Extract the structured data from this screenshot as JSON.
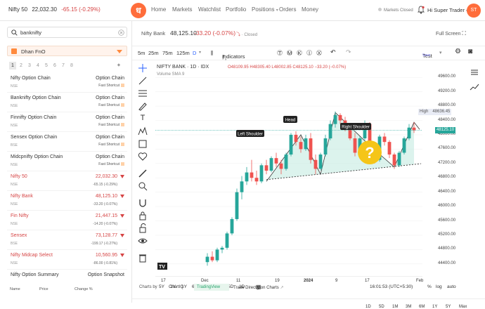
{
  "top": {
    "ticker_name": "Nifty 50",
    "ticker_price": "22,032.30",
    "ticker_change": "-65.15 (-0.29%)",
    "logo": "ध",
    "nav": [
      "Home",
      "Markets",
      "Watchlist",
      "Portfolio",
      "Positions",
      "Orders",
      "Money"
    ],
    "market_status": "Markets Closed",
    "user": "Hi Super Trader",
    "avatar": "ST"
  },
  "sidebar": {
    "search_value": "banknifty",
    "watchlist": "Dhan FnO",
    "pages": [
      "1",
      "2",
      "3",
      "4",
      "5",
      "6",
      "7",
      "8"
    ],
    "items": [
      {
        "name": "Nifty Option Chain",
        "ex": "NSE",
        "r1": "Option Chain",
        "r2": "Fast Shortcut"
      },
      {
        "name": "Banknifty Option Chain",
        "ex": "NSE",
        "r1": "Option Chain",
        "r2": "Fast Shortcut"
      },
      {
        "name": "Finnifty Option Chain",
        "ex": "NSE",
        "r1": "Option Chain",
        "r2": "Fast Shortcut"
      },
      {
        "name": "Sensex Option Chain",
        "ex": "BSE",
        "r1": "Option Chain",
        "r2": "Fast Shortcut"
      },
      {
        "name": "Midcpnifty Option Chain",
        "ex": "NSE",
        "r1": "Option Chain",
        "r2": "Fast Shortcut"
      }
    ],
    "quotes": [
      {
        "name": "Nifty 50",
        "ex": "NSE",
        "price": "22,032.30",
        "change": "-65.15 (-0.29%)"
      },
      {
        "name": "Nifty Bank",
        "ex": "NSE",
        "price": "48,125.10",
        "change": "-33.20 (-0.07%)"
      },
      {
        "name": "Fin Nifty",
        "ex": "NSE",
        "price": "21,447.15",
        "change": "-14.20 (-0.07%)"
      },
      {
        "name": "Sensex",
        "ex": "BSE",
        "price": "73,128.77",
        "change": "-199.17 (-0.27%)"
      },
      {
        "name": "Nifty Midcap Select",
        "ex": "NSE",
        "price": "10,560.95",
        "change": "-86.00 (-0.81%)"
      }
    ],
    "last_item": {
      "name": "Nifty Option Summary",
      "r1": "Option Snapshot"
    },
    "foot": [
      "Name",
      "Price",
      "Change %"
    ]
  },
  "chart": {
    "symbol_label": "Nifty Bank",
    "price": "48,125.10",
    "change": "-33.20 (-0.07%)",
    "status": "Closed",
    "fullscreen": "Full Screen",
    "timeframes": [
      "5m",
      "25m",
      "75m",
      "125m",
      "D"
    ],
    "indicators": "Indicators",
    "template": "Test",
    "save": "Save",
    "legend_title": "NIFTY BANK · 1D · IDX",
    "ohlc": "O48109.95 H48305.40 L48002.85 C48125.10 −33.20 (−0.07%)",
    "volume": "Volume SMA 9",
    "annotations": [
      "Left Shoulder",
      "Head",
      "Right Shoulder",
      "?"
    ],
    "y_ticks": [
      "49600.00",
      "49200.00",
      "48800.00",
      "48400.00",
      "48000.00",
      "47600.00",
      "47200.00",
      "46800.00",
      "46400.00",
      "46000.00",
      "45600.00",
      "45200.00",
      "44800.00",
      "44400.00"
    ],
    "high_label": "High",
    "high_value": "48636.45",
    "last_value": "48125.10",
    "x_ticks": [
      "17",
      "Dec",
      "11",
      "19",
      "2024",
      "9",
      "17",
      "Feb"
    ],
    "time": "16:01:53 (UTC+5:30)",
    "ranges": [
      "5Y",
      "1Y",
      "6M",
      "3M",
      "1M",
      "5D",
      "1D"
    ],
    "ranges_right": [
      "1D",
      "5D",
      "1M",
      "3M",
      "6M",
      "1Y",
      "5Y",
      "Max"
    ],
    "scale_opts": [
      "%",
      "log",
      "auto"
    ],
    "charts_by": "Charts by",
    "providers": [
      "ChartIQ",
      "TradingView"
    ],
    "trade_direct": "Trade Directly on Charts"
  },
  "chart_data": {
    "type": "candlestick",
    "title": "NIFTY BANK · 1D · IDX",
    "ylim": [
      44200,
      49800
    ],
    "candles": [
      [
        44450,
        44700,
        44350,
        44600
      ],
      [
        44600,
        44750,
        44450,
        44500
      ],
      [
        44500,
        44850,
        44450,
        44800
      ],
      [
        44800,
        44900,
        44700,
        44850
      ],
      [
        44850,
        45300,
        44800,
        45250
      ],
      [
        45250,
        45700,
        45200,
        45650
      ],
      [
        45650,
        46500,
        45600,
        46400
      ],
      [
        46400,
        46850,
        46200,
        46700
      ],
      [
        46700,
        47100,
        46600,
        46950
      ],
      [
        46950,
        47300,
        46700,
        46800
      ],
      [
        46800,
        47000,
        46600,
        46700
      ],
      [
        46700,
        47200,
        46650,
        47150
      ],
      [
        47150,
        47300,
        46900,
        47000
      ],
      [
        47000,
        47400,
        46950,
        47350
      ],
      [
        47350,
        47500,
        47100,
        47200
      ],
      [
        47200,
        47300,
        46900,
        47050
      ],
      [
        47050,
        47500,
        47000,
        47450
      ],
      [
        47450,
        48050,
        47400,
        48000
      ],
      [
        48000,
        48100,
        47700,
        47800
      ],
      [
        47800,
        47950,
        47500,
        47600
      ],
      [
        47600,
        48000,
        47550,
        47900
      ],
      [
        47900,
        48050,
        47200,
        47300
      ],
      [
        47300,
        47450,
        46900,
        47050
      ],
      [
        47050,
        47500,
        47000,
        47450
      ],
      [
        47450,
        48000,
        47400,
        47900
      ],
      [
        47900,
        48400,
        47850,
        48300
      ],
      [
        48300,
        48650,
        48200,
        48550
      ],
      [
        48550,
        48600,
        48300,
        48400
      ],
      [
        48400,
        48500,
        48100,
        48200
      ],
      [
        48200,
        48300,
        47850,
        47900
      ],
      [
        47900,
        48050,
        47400,
        47500
      ],
      [
        47500,
        47950,
        47450,
        47900
      ],
      [
        47900,
        48400,
        47850,
        48300
      ],
      [
        48300,
        48350,
        47500,
        47600
      ],
      [
        47600,
        47700,
        47200,
        47300
      ],
      [
        47300,
        48000,
        47250,
        47950
      ],
      [
        47950,
        48050,
        47700,
        47800
      ],
      [
        47800,
        47850,
        47350,
        47450
      ],
      [
        47450,
        47500,
        47050,
        47150
      ],
      [
        47150,
        47550,
        47100,
        47500
      ],
      [
        47500,
        47950,
        47450,
        47900
      ],
      [
        47900,
        48300,
        47850,
        48200
      ],
      [
        48200,
        48350,
        48050,
        48125
      ]
    ]
  }
}
